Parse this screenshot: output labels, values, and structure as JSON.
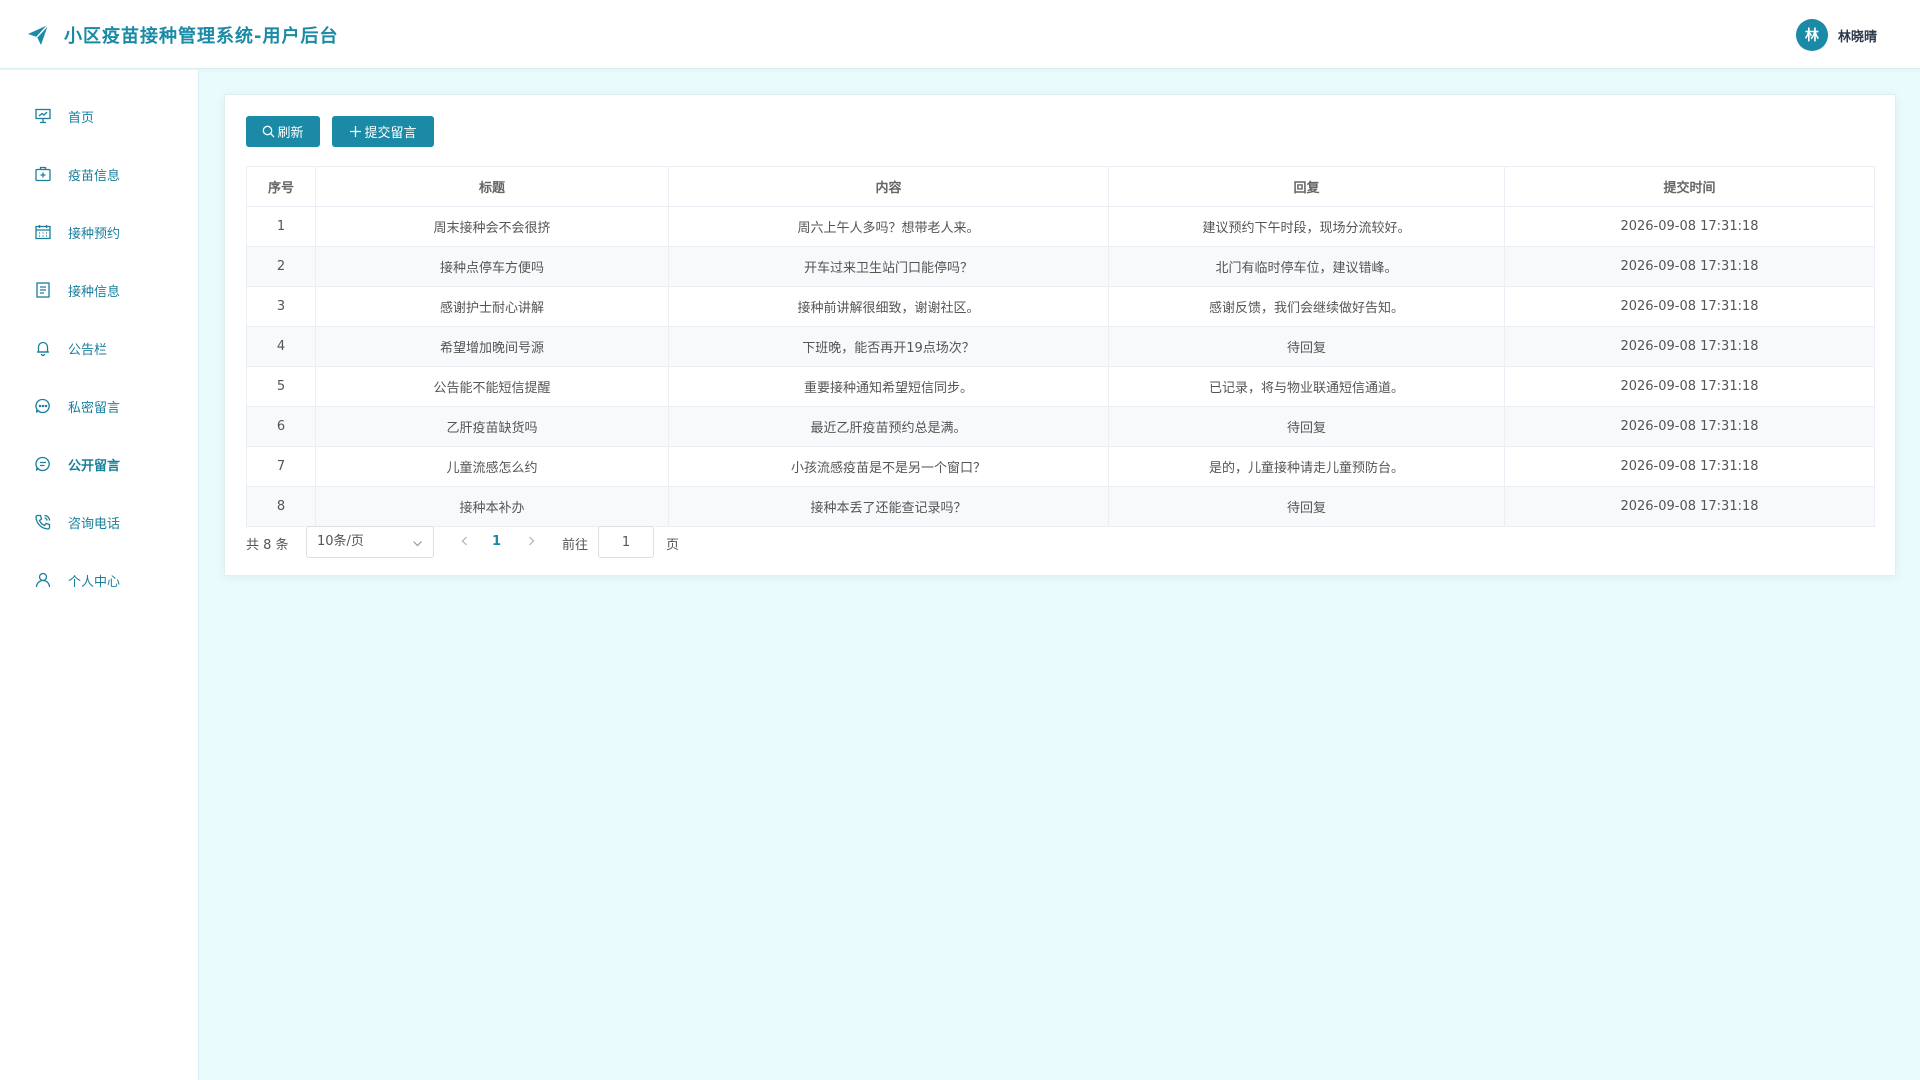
{
  "header": {
    "title": "小区疫苗接种管理系统-用户后台",
    "avatar_letter": "林",
    "username": "林晓晴"
  },
  "sidebar": {
    "items": [
      {
        "label": "首页",
        "icon": "presentation-icon"
      },
      {
        "label": "疫苗信息",
        "icon": "medical-kit-icon"
      },
      {
        "label": "接种预约",
        "icon": "calendar-icon"
      },
      {
        "label": "接种信息",
        "icon": "document-icon"
      },
      {
        "label": "公告栏",
        "icon": "bell-icon"
      },
      {
        "label": "私密留言",
        "icon": "chat-bubble-icon"
      },
      {
        "label": "公开留言",
        "icon": "chat-text-icon"
      },
      {
        "label": "咨询电话",
        "icon": "phone-icon"
      },
      {
        "label": "个人中心",
        "icon": "user-icon"
      }
    ],
    "active_index": 6
  },
  "toolbar": {
    "refresh_label": "刷新",
    "submit_label": "提交留言"
  },
  "table": {
    "columns": [
      "序号",
      "标题",
      "内容",
      "回复",
      "提交时间"
    ],
    "rows": [
      [
        "1",
        "周末接种会不会很挤",
        "周六上午人多吗？想带老人来。",
        "建议预约下午时段，现场分流较好。",
        "2026-09-08 17:31:18"
      ],
      [
        "2",
        "接种点停车方便吗",
        "开车过来卫生站门口能停吗？",
        "北门有临时停车位，建议错峰。",
        "2026-09-08 17:31:18"
      ],
      [
        "3",
        "感谢护士耐心讲解",
        "接种前讲解很细致，谢谢社区。",
        "感谢反馈，我们会继续做好告知。",
        "2026-09-08 17:31:18"
      ],
      [
        "4",
        "希望增加晚间号源",
        "下班晚，能否再开19点场次？",
        "待回复",
        "2026-09-08 17:31:18"
      ],
      [
        "5",
        "公告能不能短信提醒",
        "重要接种通知希望短信同步。",
        "已记录，将与物业联通短信通道。",
        "2026-09-08 17:31:18"
      ],
      [
        "6",
        "乙肝疫苗缺货吗",
        "最近乙肝疫苗预约总是满。",
        "待回复",
        "2026-09-08 17:31:18"
      ],
      [
        "7",
        "儿童流感怎么约",
        "小孩流感疫苗是不是另一个窗口？",
        "是的，儿童接种请走儿童预防台。",
        "2026-09-08 17:31:18"
      ],
      [
        "8",
        "接种本补办",
        "接种本丢了还能查记录吗？",
        "待回复",
        "2026-09-08 17:31:18"
      ]
    ]
  },
  "pagination": {
    "total_text": "共 8 条",
    "page_size": "10条/页",
    "current_page": "1",
    "goto_label": "前往",
    "goto_value": "1",
    "page_suffix": "页"
  },
  "colors": {
    "accent": "#1a8aa6",
    "background": "#e9fbfc"
  }
}
